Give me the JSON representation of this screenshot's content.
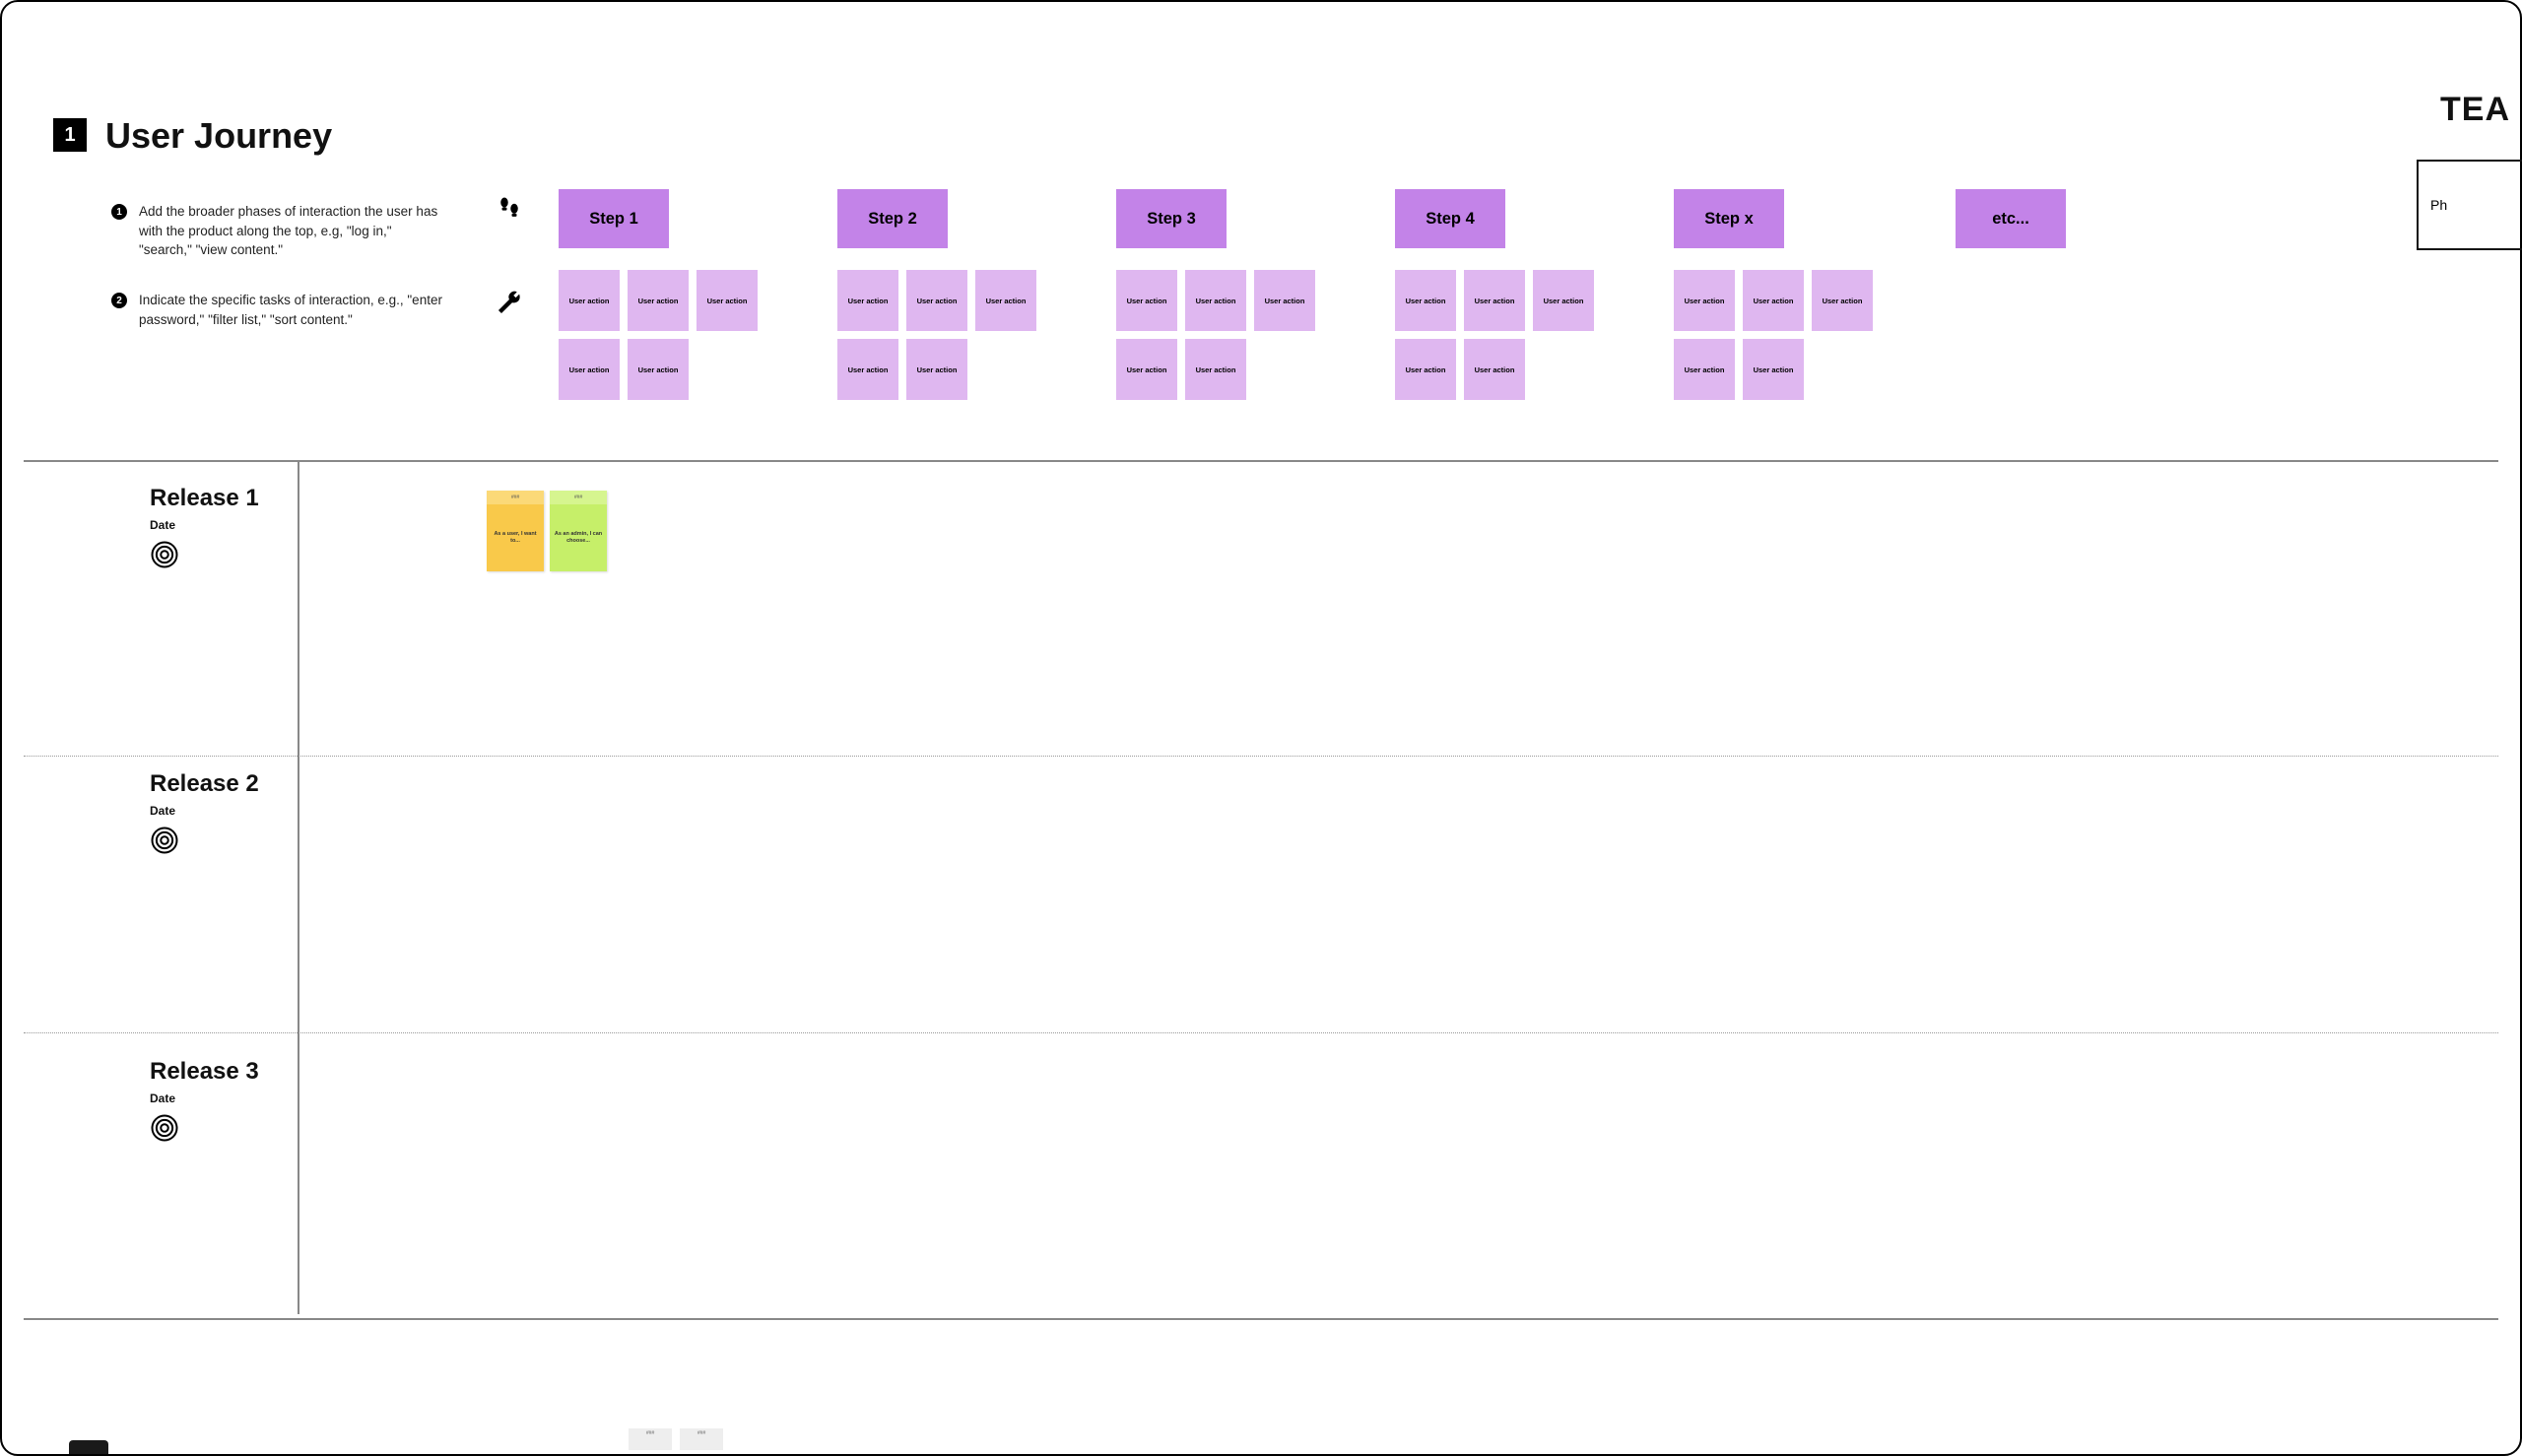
{
  "header": {
    "badge": "1",
    "title": "User Journey"
  },
  "instructions": [
    {
      "num": "1",
      "text": "Add the broader phases of interaction the user has with the product along the top, e.g, \"log in,\" \"search,\" \"view content.\""
    },
    {
      "num": "2",
      "text": "Indicate the specific tasks of interaction, e.g., \"enter password,\" \"filter list,\" \"sort content.\""
    }
  ],
  "steps": [
    {
      "label": "Step 1",
      "actions_row1": 3,
      "actions_row2": 2
    },
    {
      "label": "Step 2",
      "actions_row1": 3,
      "actions_row2": 2
    },
    {
      "label": "Step 3",
      "actions_row1": 3,
      "actions_row2": 2
    },
    {
      "label": "Step 4",
      "actions_row1": 3,
      "actions_row2": 2
    },
    {
      "label": "Step x",
      "actions_row1": 3,
      "actions_row2": 2
    }
  ],
  "user_action_label": "User action",
  "etc_label": "etc...",
  "team_label": "TEA",
  "team_box_text": "Ph",
  "releases": [
    {
      "title": "Release 1",
      "date": "Date"
    },
    {
      "title": "Release 2",
      "date": "Date"
    },
    {
      "title": "Release 3",
      "date": "Date"
    }
  ],
  "stories": [
    {
      "tab": "###",
      "body": "As a user, I want to...",
      "color": "yellow"
    },
    {
      "tab": "###",
      "body": "As an admin, I can choose...",
      "color": "green"
    }
  ],
  "mini_stickies": [
    "###",
    "###"
  ],
  "colors": {
    "step_bg": "#c383e8",
    "action_bg": "#dfb7f0",
    "story_yellow": "#f9c94a",
    "story_green": "#c6ef69"
  }
}
